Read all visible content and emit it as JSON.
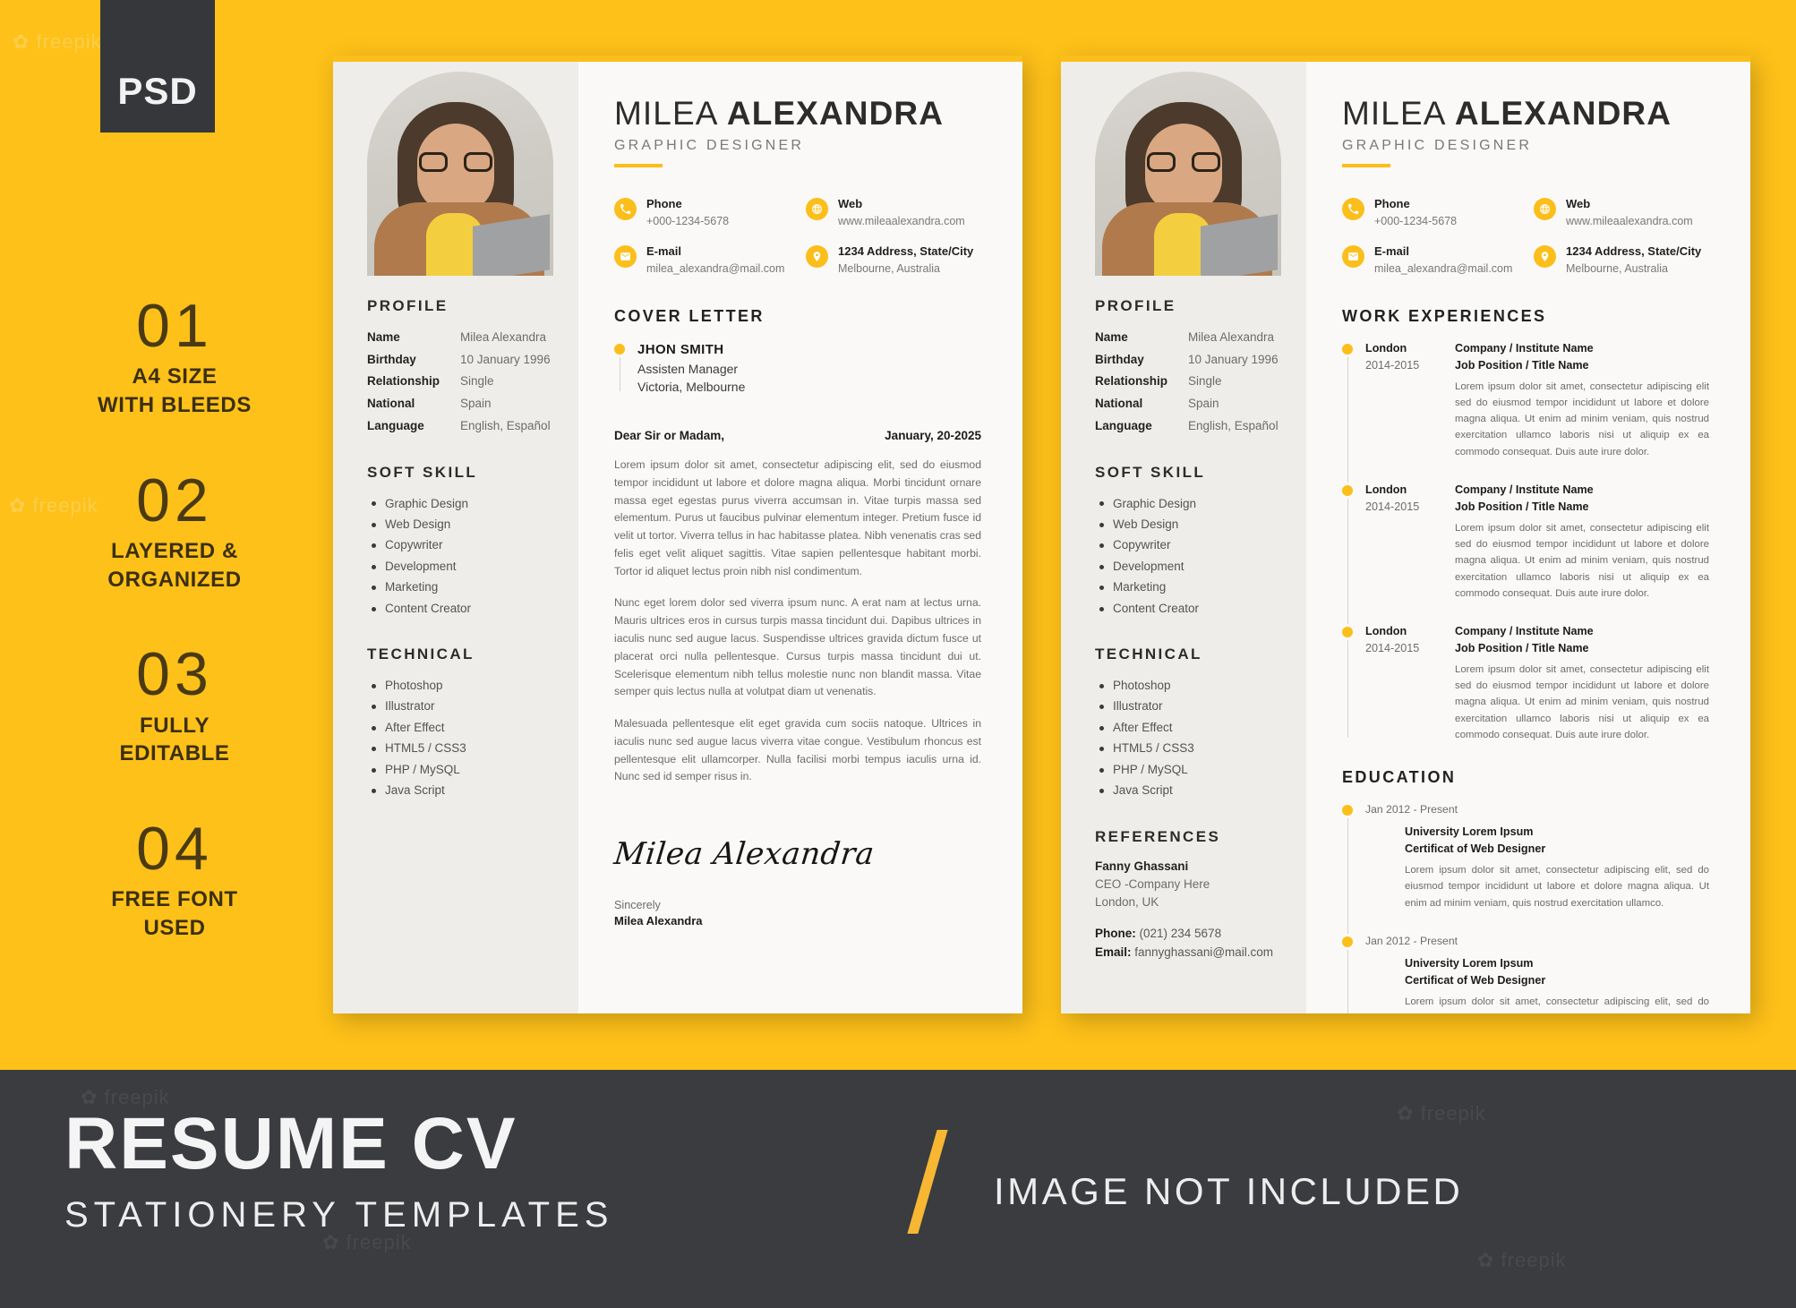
{
  "badge": {
    "label": "PSD"
  },
  "features": [
    {
      "number": "01",
      "label": "A4 SIZE\nWITH BLEEDS"
    },
    {
      "number": "02",
      "label": "LAYERED &\nORGANIZED"
    },
    {
      "number": "03",
      "label": "FULLY\nEDITABLE"
    },
    {
      "number": "04",
      "label": "FREE FONT\nUSED"
    }
  ],
  "resume": {
    "name_first": "MILEA ",
    "name_last": "ALEXANDRA",
    "role": "GRAPHIC DESIGNER",
    "contacts": [
      {
        "icon": "phone-icon",
        "label": "Phone",
        "value": "+000-1234-5678"
      },
      {
        "icon": "globe-icon",
        "label": "Web",
        "value": "www.mileaalexandra.com"
      },
      {
        "icon": "mail-icon",
        "label": "E-mail",
        "value": "milea_alexandra@mail.com"
      },
      {
        "icon": "location-pin-icon",
        "label": "1234 Address, State/City",
        "value": "Melbourne, Australia"
      }
    ],
    "profile": {
      "title": "PROFILE",
      "rows": [
        {
          "key": "Name",
          "value": "Milea Alexandra"
        },
        {
          "key": "Birthday",
          "value": "10 January 1996"
        },
        {
          "key": "Relationship",
          "value": "Single"
        },
        {
          "key": "National",
          "value": "Spain"
        },
        {
          "key": "Language",
          "value": "English, Español"
        }
      ]
    },
    "soft_skill": {
      "title": "SOFT SKILL",
      "items": [
        "Graphic Design",
        "Web Design",
        "Copywriter",
        "Development",
        "Marketing",
        "Content Creator"
      ]
    },
    "technical": {
      "title": "TECHNICAL",
      "items": [
        "Photoshop",
        "Illustrator",
        "After Effect",
        "HTML5 / CSS3",
        "PHP / MySQL",
        "Java Script"
      ]
    },
    "references": {
      "title": "REFERENCES",
      "name": "Fanny Ghassani",
      "company": "CEO -Company Here",
      "location": "London, UK",
      "phone_label": "Phone:",
      "phone_value": " (021) 234 5678",
      "email_label": "Email:",
      "email_value": " fannyghassani@mail.com"
    },
    "cover_letter": {
      "title": "COVER LETTER",
      "recipient_name": "JHON SMITH",
      "recipient_role": "Assisten Manager",
      "recipient_location": "Victoria, Melbourne",
      "salutation": "Dear Sir or Madam,",
      "date": "January, 20-2025",
      "paragraphs": [
        "Lorem ipsum dolor sit amet, consectetur adipiscing elit, sed do eiusmod tempor incididunt ut labore et dolore magna aliqua. Morbi tincidunt ornare massa eget egestas purus viverra accumsan in. Vitae turpis massa sed elementum. Purus ut faucibus pulvinar elementum integer. Pretium fusce id velit ut tortor. Viverra tellus in hac habitasse platea. Nibh venenatis cras sed felis eget velit aliquet sagittis. Vitae sapien pellentesque habitant morbi. Tortor id aliquet lectus proin nibh nisl condimentum.",
        "Nunc eget lorem dolor sed viverra ipsum nunc. A erat nam at lectus urna. Mauris ultrices eros in cursus turpis massa tincidunt dui. Dapibus ultrices in iaculis nunc sed augue lacus. Suspendisse ultrices gravida dictum fusce ut placerat orci nulla pellentesque. Cursus turpis massa tincidunt dui ut. Scelerisque elementum nibh tellus molestie nunc non blandit massa. Vitae semper quis lectus nulla at volutpat diam ut venenatis.",
        "Malesuada pellentesque elit eget gravida cum sociis natoque. Ultrices in iaculis nunc sed augue lacus viverra vitae congue. Vestibulum rhoncus est pellentesque elit ullamcorper. Nulla facilisi morbi tempus iaculis urna id. Nunc sed id semper risus in."
      ],
      "signature": "Milea Alexandra",
      "sincerely": "Sincerely",
      "sign_name": "Milea Alexandra"
    },
    "work": {
      "title": "WORK EXPERIENCES",
      "items": [
        {
          "city": "London",
          "years": "2014-2015",
          "company": "Company / Institute Name",
          "job": "Job Position / Title Name",
          "desc": "Lorem ipsum dolor sit amet, consectetur adipiscing elit sed do eiusmod tempor incididunt ut labore et dolore magna aliqua. Ut enim ad minim veniam, quis nostrud exercitation ullamco laboris nisi ut aliquip ex ea commodo consequat. Duis aute irure dolor."
        },
        {
          "city": "London",
          "years": "2014-2015",
          "company": "Company / Institute Name",
          "job": "Job Position / Title Name",
          "desc": "Lorem ipsum dolor sit amet, consectetur adipiscing elit sed do eiusmod tempor incididunt ut labore et dolore magna aliqua. Ut enim ad minim veniam, quis nostrud exercitation ullamco laboris nisi ut aliquip ex ea commodo consequat. Duis aute irure dolor."
        },
        {
          "city": "London",
          "years": "2014-2015",
          "company": "Company / Institute Name",
          "job": "Job Position / Title Name",
          "desc": "Lorem ipsum dolor sit amet, consectetur adipiscing elit sed do eiusmod tempor incididunt ut labore et dolore magna aliqua. Ut enim ad minim veniam, quis nostrud exercitation ullamco laboris nisi ut aliquip ex ea commodo consequat. Duis aute irure dolor."
        }
      ]
    },
    "education": {
      "title": "EDUCATION",
      "items": [
        {
          "when": "Jan 2012 - Present",
          "university": "University Lorem Ipsum",
          "certificate": "Certificat of Web Designer",
          "desc": "Lorem ipsum dolor sit amet, consectetur adipiscing elit, sed do eiusmod tempor incididunt ut labore et dolore magna aliqua. Ut enim ad minim veniam, quis nostrud exercitation ullamco."
        },
        {
          "when": "Jan 2012 - Present",
          "university": "University Lorem Ipsum",
          "certificate": "Certificat of Web Designer",
          "desc": "Lorem ipsum dolor sit amet, consectetur adipiscing elit, sed do eiusmod tempor incididunt ut labore et dolore magna aliqua. Ut enim ad minim veniam, quis nostrud exercitation ullamco."
        }
      ]
    }
  },
  "banner": {
    "title": "RESUME CV",
    "subtitle": "STATIONERY TEMPLATES",
    "note": "IMAGE NOT INCLUDED"
  },
  "colors": {
    "accent_yellow": "#FEC119",
    "icon_yellow": "#FBBE1A",
    "dark": "#3A3C40",
    "sidebar": "#EFEDE9",
    "paper": "#FAF9F7"
  },
  "watermark": "freepik"
}
